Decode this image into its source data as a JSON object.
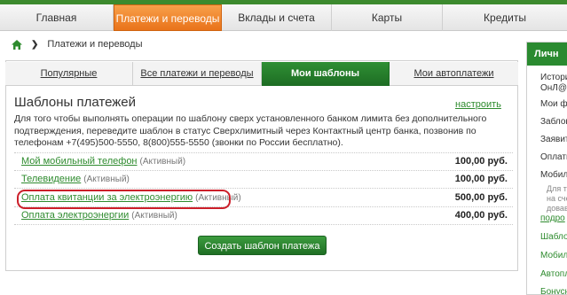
{
  "main_nav": {
    "items": [
      {
        "label": "Главная"
      },
      {
        "label": "Платежи и переводы"
      },
      {
        "label": "Вклады и счета"
      },
      {
        "label": "Карты"
      },
      {
        "label": "Кредиты"
      }
    ]
  },
  "breadcrumb": {
    "current": "Платежи и переводы"
  },
  "tabs": [
    {
      "label": "Популярные"
    },
    {
      "label": "Все платежи и переводы"
    },
    {
      "label": "Мои шаблоны"
    },
    {
      "label": "Мои автоплатежи"
    }
  ],
  "templates": {
    "title": "Шаблоны платежей",
    "settings_link": "настроить",
    "description": "Для того чтобы выполнять операции по шаблону сверх установленного банком лимита без дополнительного подтверждения, переведите шаблон в статус Сверхлимитный через Контактный центр банка, позвонив по телефонам +7(495)500-5550, 8(800)555-5550 (звонки по России бесплатно).",
    "items": [
      {
        "name": "Мой мобильный телефон",
        "status": "(Активный)",
        "amount": "100,00 руб."
      },
      {
        "name": "Телевидение",
        "status": "(Активный)",
        "amount": "100,00 руб."
      },
      {
        "name": "Оплата квитанции за электроэнергию",
        "status": "(Активный)",
        "amount": "500,00 руб."
      },
      {
        "name": "Оплата электроэнергии",
        "status": "(Активный)",
        "amount": "400,00 руб."
      }
    ],
    "create_button": "Создать шаблон платежа"
  },
  "sidebar": {
    "title": "Личн",
    "items": [
      {
        "label": "Истори"
      },
      {
        "label": "ОнЛ@й"
      },
      {
        "label": "Мои ф"
      },
      {
        "label": "Заблок"
      },
      {
        "label": "Заявит"
      },
      {
        "label": "Оплати"
      },
      {
        "label": "Мобил"
      },
      {
        "label": "Для т"
      },
      {
        "label": "на сче"
      },
      {
        "label": "довав"
      },
      {
        "label": "подро"
      },
      {
        "label": "Шабло"
      },
      {
        "label": "Мобил"
      },
      {
        "label": "Автопл"
      },
      {
        "label": "Бонусн"
      }
    ]
  },
  "colors": {
    "brand_green": "#2a8a30",
    "active_orange": "#e9731a",
    "highlight_red": "#cc1f2a",
    "link_green": "#2e8b2e"
  }
}
